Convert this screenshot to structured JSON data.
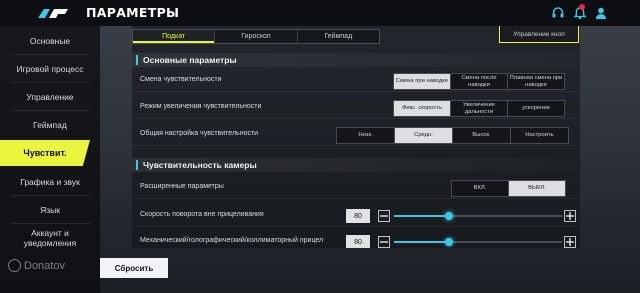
{
  "header": {
    "title": "ПАРАМЕТРЫ",
    "icons": [
      "headset-icon",
      "bell-icon",
      "notification-badge",
      "user-icon"
    ]
  },
  "sidebar": {
    "items": [
      {
        "label": "Основные",
        "active": false
      },
      {
        "label": "Игровой процесс",
        "active": false
      },
      {
        "label": "Управление",
        "active": false
      },
      {
        "label": "Геймпад",
        "active": false
      },
      {
        "label": "Чувствит.",
        "active": true
      },
      {
        "label": "Графика и звук",
        "active": false
      },
      {
        "label": "Язык",
        "active": false
      },
      {
        "label": "Аккаунт и уведомления",
        "active": false
      }
    ]
  },
  "tabs": [
    {
      "label": "Подкат",
      "active": true
    },
    {
      "label": "Гироскоп",
      "active": false
    },
    {
      "label": "Геймпад",
      "active": false
    }
  ],
  "control_button_label": "Управление кноп",
  "sections": {
    "basic": {
      "title": "Основные параметры",
      "rows": [
        {
          "label": "Смена чувствительности",
          "options": [
            "Смена при наводке",
            "Смена после наводки",
            "Плавная смена при наводке"
          ],
          "selected": 0
        },
        {
          "label": "Режим увеличения чувствительности",
          "options": [
            "Фикс. скорость",
            "Увеличение дальности",
            "ускорение"
          ],
          "selected": 0
        },
        {
          "label": "Общая настройка чувствительности",
          "options": [
            "Низк.",
            "Средн.",
            "Высок.",
            "Настроить"
          ],
          "selected": 1
        }
      ]
    },
    "camera": {
      "title": "Чувствительность камеры",
      "advanced": {
        "label": "Расширенные параметры",
        "options": [
          "ВКЛ.",
          "ВЫКЛ."
        ],
        "selected": 1
      },
      "sliders": [
        {
          "label": "Скорость поворота вне прицеливания",
          "value": "80",
          "fraction": 0.33
        },
        {
          "label": "Механический/голографический/коллиматорный прицел",
          "value": "80",
          "fraction": 0.33
        }
      ]
    }
  },
  "reset_label": "Сбросить",
  "watermark": "Donatov"
}
